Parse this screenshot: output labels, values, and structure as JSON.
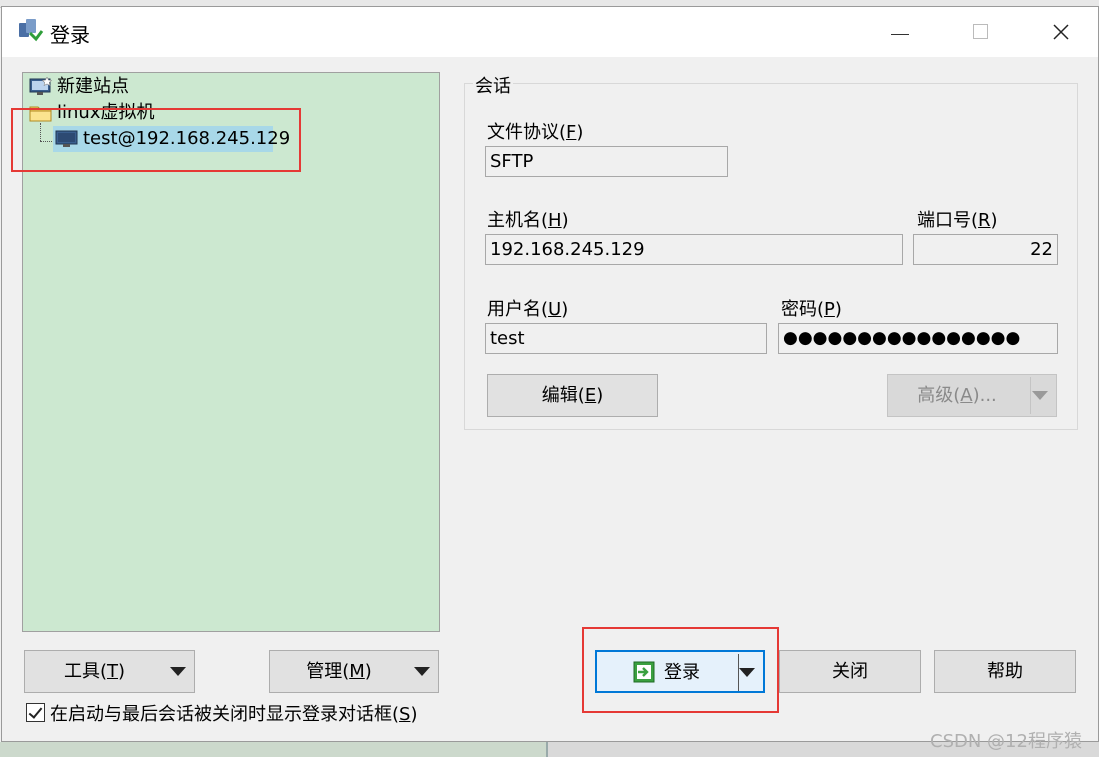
{
  "window": {
    "title": "登录"
  },
  "tree": {
    "items": [
      {
        "label": "新建站点"
      },
      {
        "label": "linux虚拟机"
      },
      {
        "label": "test@192.168.245.129"
      }
    ]
  },
  "session": {
    "group_title": "会话",
    "protocol_label": "文件协议(",
    "protocol_key": "F",
    "protocol_value": "SFTP",
    "host_label": "主机名(",
    "host_key": "H",
    "host_value": "192.168.245.129",
    "port_label": "端口号(",
    "port_key": "R",
    "port_value": "22",
    "user_label": "用户名(",
    "user_key": "U",
    "user_value": "test",
    "password_label": "密码(",
    "password_key": "P",
    "password_value": "●●●●●●●●●●●●●●●●",
    "edit_label": "编辑(",
    "edit_key": "E",
    "advanced_label": "高级(",
    "advanced_key": "A",
    "advanced_suffix": ")..."
  },
  "buttons": {
    "tools_label": "工具(",
    "tools_key": "T",
    "manage_label": "管理(",
    "manage_key": "M",
    "login_label": "登录",
    "close_label": "关闭",
    "help_label": "帮助"
  },
  "checkbox": {
    "label": "在启动与最后会话被关闭时显示登录对话框(",
    "key": "S",
    "checked": true
  },
  "watermark": "CSDN @12程序猿",
  "colors": {
    "tree_bg": "#cce8d0",
    "selection": "#a8d8e8",
    "highlight_box": "#e53935",
    "focus_border": "#0078d7"
  }
}
